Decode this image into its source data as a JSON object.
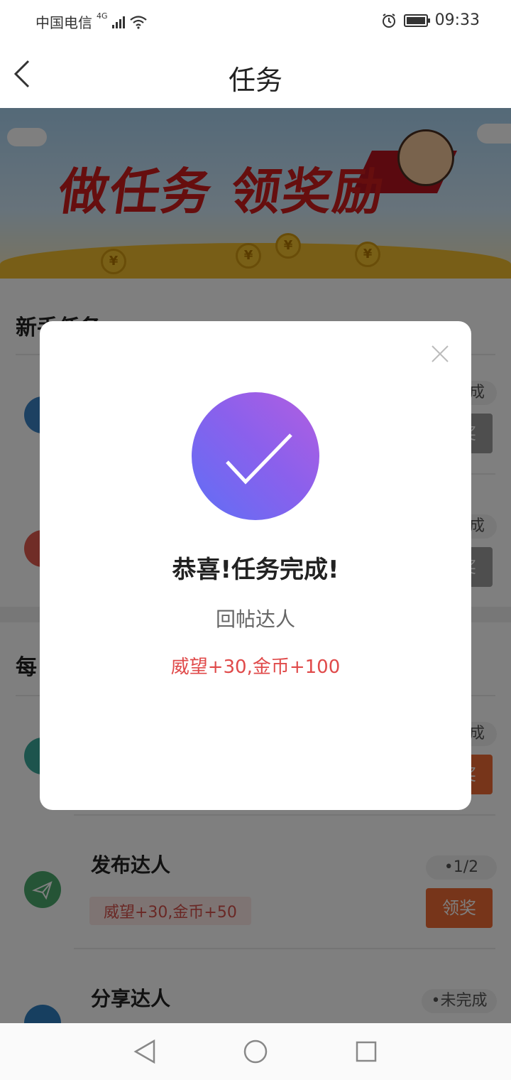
{
  "status_bar": {
    "carrier": "中国电信",
    "network": "4G",
    "time": "09:33",
    "battery_level": 0.9
  },
  "header": {
    "title": "任务"
  },
  "banner": {
    "headline": "做任务 领奖励"
  },
  "sections": [
    {
      "title": "新手任务",
      "tasks": [
        {
          "progress": "未完成",
          "claim_label": "领奖"
        },
        {
          "progress": "未完成",
          "claim_label": "领奖"
        }
      ]
    },
    {
      "title": "每日任务",
      "tasks": [
        {
          "name": "回帖达人",
          "reward": "威望+30,金币+100",
          "progress": "已完成",
          "claim_label": "领奖"
        },
        {
          "name": "发布达人",
          "reward": "威望+30,金币+50",
          "progress": "•1/2",
          "claim_label": "领奖"
        },
        {
          "name": "分享达人",
          "reward": "",
          "progress": "•未完成",
          "claim_label": "领奖"
        }
      ]
    }
  ],
  "modal": {
    "title": "恭喜!任务完成!",
    "task_name": "回帖达人",
    "reward": "威望+30,金币+100"
  },
  "colors": {
    "accent": "#ee6b34",
    "reward_red": "#e04a4a",
    "check_gradient_start": "#5f6ff5",
    "check_gradient_end": "#b25ee0"
  }
}
